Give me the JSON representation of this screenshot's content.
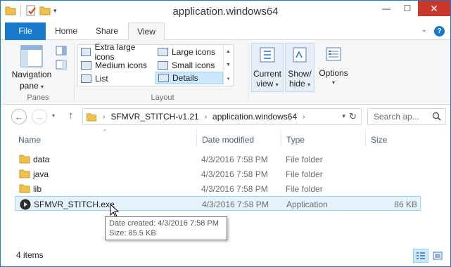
{
  "window": {
    "title": "application.windows64",
    "minimize": "—",
    "maximize": "☐",
    "close": "✕"
  },
  "ribbon": {
    "tabs": {
      "file": "File",
      "home": "Home",
      "share": "Share",
      "view": "View"
    },
    "active_tab": "View",
    "navigation_pane": {
      "line1": "Navigation",
      "line2": "pane"
    },
    "panes_group": "Panes",
    "layout_options": {
      "extra_large": "Extra large icons",
      "large": "Large icons",
      "medium": "Medium icons",
      "small": "Small icons",
      "list": "List",
      "details": "Details"
    },
    "layout_selected": "Details",
    "layout_group": "Layout",
    "current_view": {
      "line1": "Current",
      "line2": "view"
    },
    "show_hide": {
      "line1": "Show/",
      "line2": "hide"
    },
    "options": "Options"
  },
  "address": {
    "crumbs": [
      "SFMVR_STITCH-v1.21",
      "application.windows64"
    ],
    "search_placeholder": "Search ap..."
  },
  "columns": {
    "name": "Name",
    "date": "Date modified",
    "type": "Type",
    "size": "Size"
  },
  "files": [
    {
      "name": "data",
      "date": "4/3/2016 7:58 PM",
      "type": "File folder",
      "size": ""
    },
    {
      "name": "java",
      "date": "4/3/2016 7:58 PM",
      "type": "File folder",
      "size": ""
    },
    {
      "name": "lib",
      "date": "4/3/2016 7:58 PM",
      "type": "File folder",
      "size": ""
    },
    {
      "name": "SFMVR_STITCH.exe",
      "date": "4/3/2016 7:58 PM",
      "type": "Application",
      "size": "86 KB"
    }
  ],
  "tooltip": {
    "line1": "Date created: 4/3/2016 7:58 PM",
    "line2": "Size: 85.5 KB"
  },
  "status": {
    "count": "4 items"
  },
  "colors": {
    "accent": "#1979ca",
    "selection": "#cce8ff",
    "close": "#c7382b",
    "folder": "#f0c04a"
  },
  "icons": [
    "folder-icon",
    "properties-icon",
    "new-folder-icon",
    "back-arrow-icon",
    "forward-arrow-icon",
    "up-arrow-icon",
    "refresh-icon",
    "search-icon",
    "application-icon",
    "details-view-icon",
    "tiles-view-icon"
  ]
}
